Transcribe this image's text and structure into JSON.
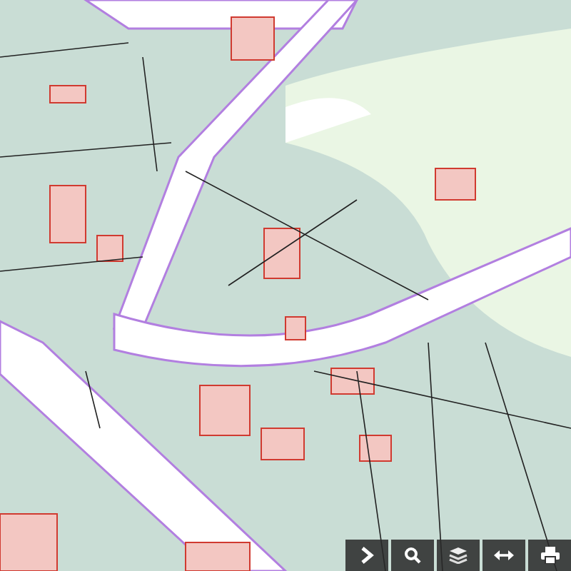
{
  "toolbar": {
    "buttons": [
      {
        "kind": "expand"
      },
      {
        "kind": "search"
      },
      {
        "kind": "layers"
      },
      {
        "kind": "measure"
      },
      {
        "kind": "print"
      }
    ]
  }
}
